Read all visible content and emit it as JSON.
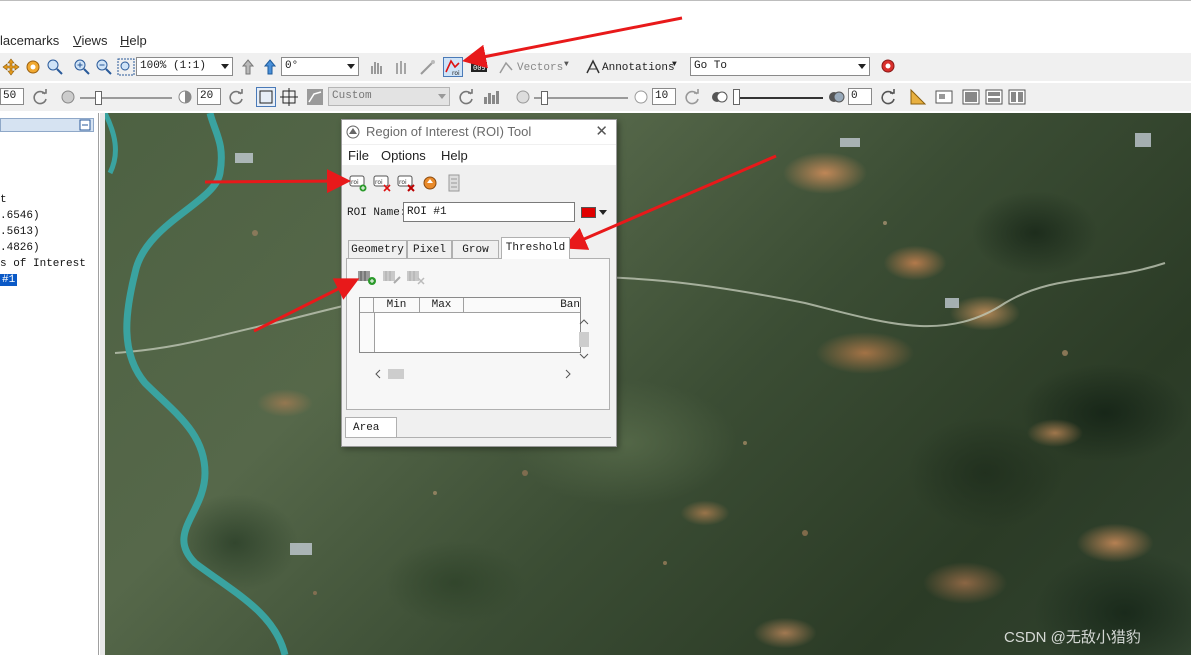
{
  "menubar": {
    "items": [
      {
        "label": "lacemarks",
        "underline": ""
      },
      {
        "label": "iews",
        "underline": "V"
      },
      {
        "label": "elp",
        "underline": "H"
      }
    ]
  },
  "toolbar1": {
    "zoom_value": "100% (1:1)",
    "rotation_value": "0°",
    "vectors_label": "Vectors",
    "annotations_label": "Annotations",
    "goto_value": "Go To"
  },
  "toolbar2": {
    "left_value": "50",
    "brightness_value": "20",
    "stretch_value": "Custom",
    "sharpen_value": "10",
    "transparency_value": "0"
  },
  "left_panel": {
    "lines": [
      {
        "text": "t",
        "selected": false
      },
      {
        "text": ".6546)",
        "selected": false
      },
      {
        "text": ".5613)",
        "selected": false
      },
      {
        "text": ".4826)",
        "selected": false
      },
      {
        "text": "s of Interest",
        "selected": false
      },
      {
        "text": "#1",
        "selected": true
      }
    ]
  },
  "roi_dialog": {
    "title": "Region of Interest (ROI) Tool",
    "menu": [
      "File",
      "Options",
      "Help"
    ],
    "roi_name_label": "ROI Name:",
    "roi_name_value": "ROI #1",
    "roi_color": "#e00000",
    "tabs": [
      "Geometry",
      "Pixel",
      "Grow",
      "Threshold"
    ],
    "active_tab": "Threshold",
    "table_headers": [
      "Min",
      "Max",
      "Ban"
    ],
    "bottom_tab": "Area"
  },
  "watermark": "CSDN @无敌小猎豹",
  "colors": {
    "annotation_arrow": "#e8191a",
    "selection_blue": "#0a59c6",
    "river": "#3aa3a0"
  }
}
